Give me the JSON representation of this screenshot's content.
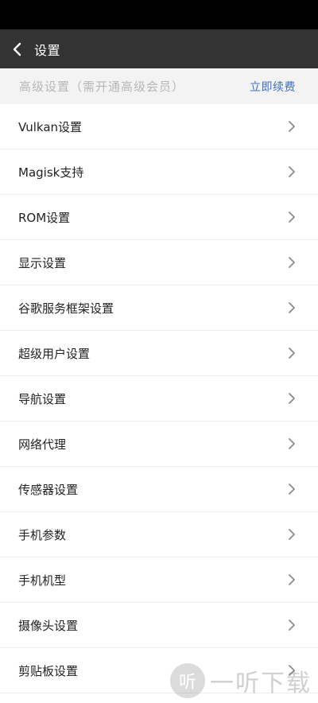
{
  "header": {
    "title": "设置",
    "back_icon": "chevron-left-icon"
  },
  "premium": {
    "label": "高级设置（需开通高级会员）",
    "action": "立即续费",
    "action_color": "#3f6fc1"
  },
  "menu": {
    "items": [
      {
        "label": "Vulkan设置"
      },
      {
        "label": "Magisk支持"
      },
      {
        "label": "ROM设置"
      },
      {
        "label": "显示设置"
      },
      {
        "label": "谷歌服务框架设置"
      },
      {
        "label": "超级用户设置"
      },
      {
        "label": "导航设置"
      },
      {
        "label": "网络代理"
      },
      {
        "label": "传感器设置"
      },
      {
        "label": "手机参数"
      },
      {
        "label": "手机机型"
      },
      {
        "label": "摄像头设置"
      },
      {
        "label": "剪贴板设置"
      }
    ],
    "item_icon": "chevron-right-icon"
  },
  "watermark": {
    "logo_char": "听",
    "text": "一听下载"
  }
}
